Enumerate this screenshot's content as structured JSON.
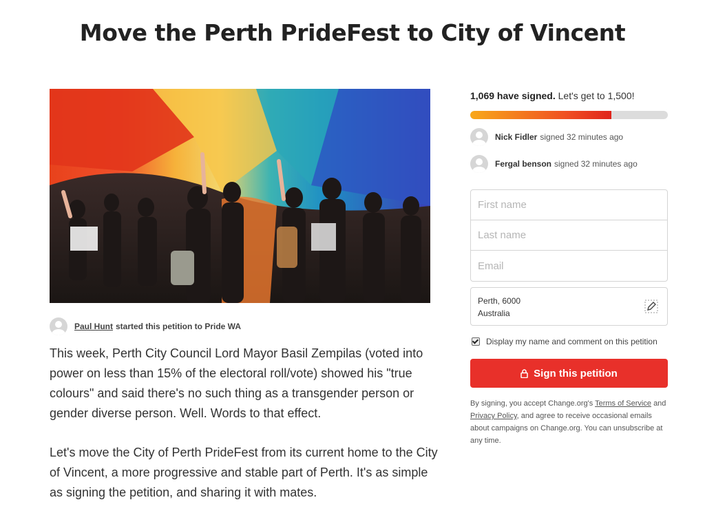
{
  "petition": {
    "title": "Move the Perth PrideFest to City of Vincent",
    "starter_name": "Paul Hunt",
    "starter_text": "started this petition to Pride WA",
    "body": [
      "This week, Perth City Council Lord Mayor Basil Zempilas (voted into power on less than 15% of the electoral roll/vote) showed his \"true colours\" and said there's no such thing as a transgender person or gender diverse person. Well. Words to that effect.",
      "Let's move the City of Perth PrideFest from its current home to the City of Vincent, a more progressive and stable part of Perth. It's as simple as signing the petition, and sharing it with mates."
    ]
  },
  "sidebar": {
    "signed_count": "1,069 have signed.",
    "goal_text": "Let's get to 1,500!",
    "progress_fraction": 0.7127,
    "progress_colors": [
      "#f8a81a",
      "#e0241c"
    ],
    "recent_signers": [
      {
        "name": "Nick Fidler",
        "text": "signed 32 minutes ago"
      },
      {
        "name": "Fergal benson",
        "text": "signed 32 minutes ago"
      }
    ],
    "form": {
      "first_name_placeholder": "First name",
      "last_name_placeholder": "Last name",
      "email_placeholder": "Email",
      "location_line1": "Perth, 6000",
      "location_line2": "Australia",
      "display_label": "Display my name and comment on this petition",
      "display_checked": true,
      "sign_button": "Sign this petition",
      "sign_button_color": "#e8302a"
    },
    "legal": {
      "t1": "By signing, you accept Change.org's",
      "terms": "Terms of Service",
      "t2": "and",
      "privacy": "Privacy Policy",
      "t3": ", and agree to receive occasional emails about campaigns on Change.org. You can unsubscribe at any time."
    }
  },
  "icons": {
    "edit": "pencil-edit-icon",
    "lock": "lock-icon",
    "checkbox": "checkbox-checked-icon",
    "avatar": "default-avatar-icon"
  }
}
